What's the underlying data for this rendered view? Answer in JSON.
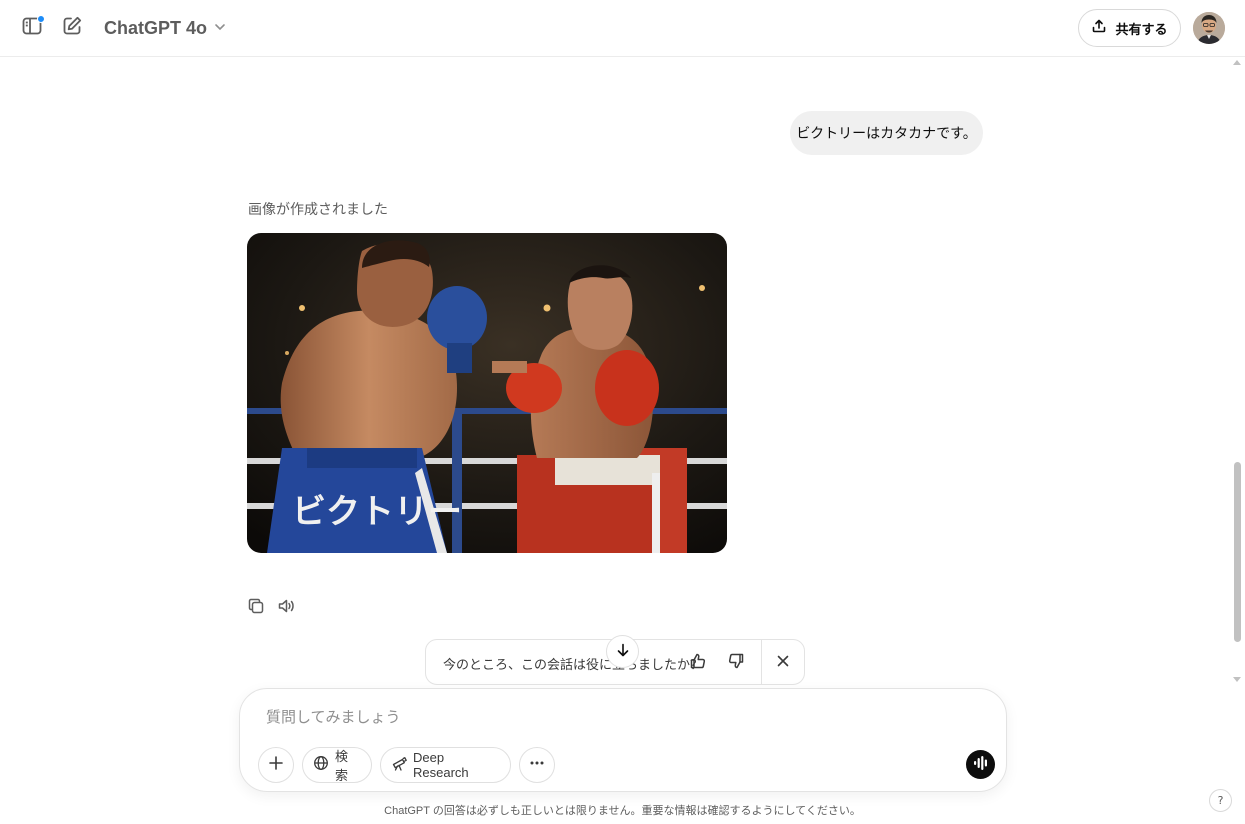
{
  "header": {
    "model_name": "ChatGPT 4o",
    "share_label": "共有する"
  },
  "conversation": {
    "user_message": "ビクトリーはカタカナです。",
    "assistant_status": "画像が作成されました",
    "image_caption_text": "ビクトリー"
  },
  "feedback": {
    "question": "今のところ、この会話は役に立ちましたか？"
  },
  "composer": {
    "placeholder": "質問してみましょう",
    "search_label": "検索",
    "deep_research_label": "Deep Research"
  },
  "footer": {
    "disclaimer": "ChatGPT の回答は必ずしも正しいとは限りません。重要な情報は確認するようにしてください。",
    "help_label": "?"
  },
  "icons": {
    "sidebar_toggle": "sidebar-icon",
    "new_chat": "edit-icon",
    "share": "upload-icon",
    "copy": "copy-icon",
    "speak": "speaker-icon",
    "thumb_up": "thumbs-up-icon",
    "thumb_down": "thumbs-down-icon",
    "close": "close-icon",
    "scroll_down": "arrow-down-icon",
    "plus": "plus-icon",
    "globe": "globe-icon",
    "telescope": "telescope-icon",
    "more": "more-horizontal-icon",
    "voice": "voice-waveform-icon"
  },
  "colors": {
    "notification_dot": "#1d8cf8",
    "user_bubble_bg": "#f0f0f0",
    "voice_button_bg": "#0d0d0d"
  }
}
